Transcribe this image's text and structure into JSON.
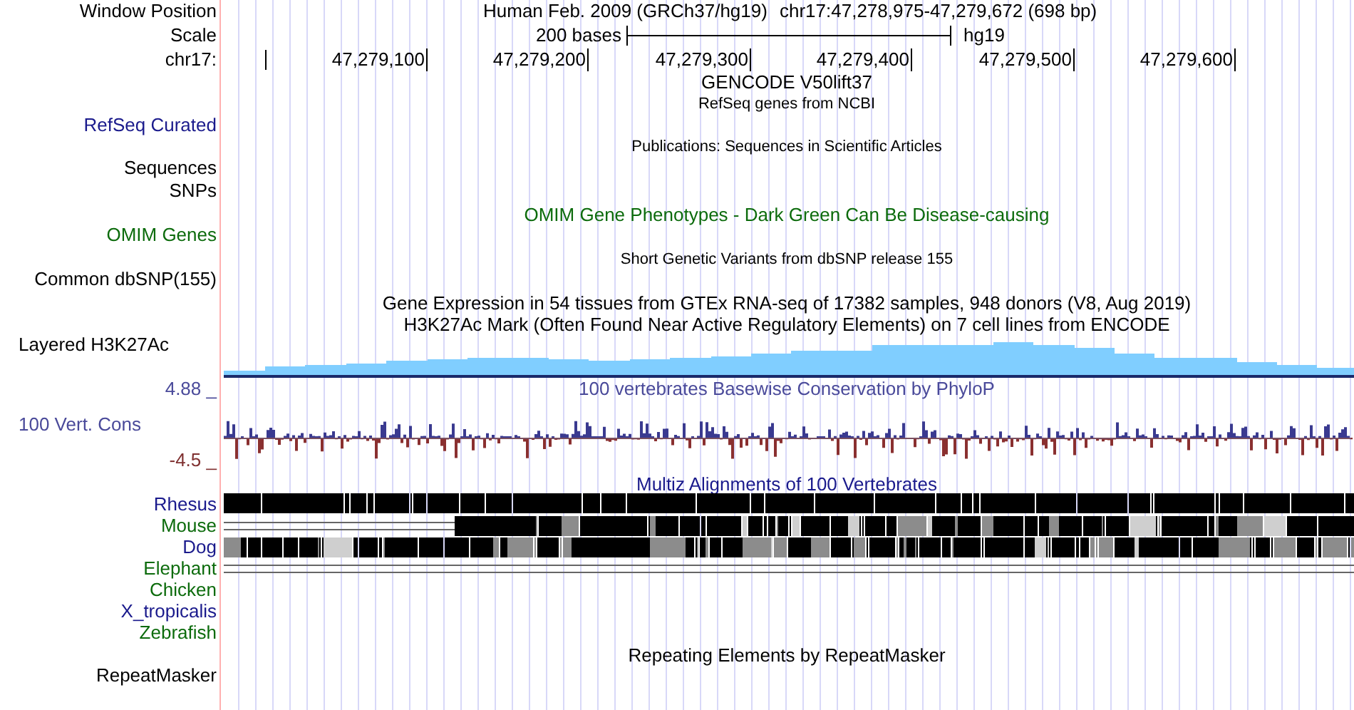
{
  "header": {
    "assembly_title": "Human Feb. 2009 (GRCh37/hg19)",
    "position": "chr17:47,278,975-47,279,672 (698 bp)",
    "scale_text": "200 bases",
    "scale_assembly": "hg19"
  },
  "ruler_ticks": [
    "47,279,100",
    "47,279,200",
    "47,279,300",
    "47,279,400",
    "47,279,500",
    "47,279,600"
  ],
  "side_labels": [
    {
      "text": "Window Position",
      "kind": "track",
      "color": "#000000"
    },
    {
      "text": "Scale",
      "kind": "track",
      "color": "#000000"
    },
    {
      "text": "chr17:",
      "kind": "track",
      "color": "#000000"
    },
    {
      "text": "RefSeq Curated",
      "kind": "track",
      "color": "#1a1a8c"
    },
    {
      "text": "Sequences",
      "kind": "track",
      "color": "#000000"
    },
    {
      "text": "SNPs",
      "kind": "track",
      "color": "#000000"
    },
    {
      "text": "OMIM Genes",
      "kind": "track",
      "color": "#0c6b0c"
    },
    {
      "text": "Common dbSNP(155)",
      "kind": "track",
      "color": "#000000"
    },
    {
      "text": "Layered H3K27Ac",
      "kind": "composite",
      "color": "#000000"
    },
    {
      "text": "4.88 _",
      "kind": "track",
      "color": "#4a4a9a"
    },
    {
      "text": "100 Vert. Cons",
      "kind": "composite",
      "color": "#4a4a9a"
    },
    {
      "text": "-4.5 _",
      "kind": "track",
      "color": "#7f3030"
    },
    {
      "text": "Rhesus",
      "kind": "track",
      "color": "#1a1a8c"
    },
    {
      "text": "Mouse",
      "kind": "track",
      "color": "#0c6b0c"
    },
    {
      "text": "Dog",
      "kind": "track",
      "color": "#1a1a8c"
    },
    {
      "text": "Elephant",
      "kind": "track",
      "color": "#0c6b0c"
    },
    {
      "text": "Chicken",
      "kind": "track",
      "color": "#0c6b0c"
    },
    {
      "text": "X_tropicalis",
      "kind": "track",
      "color": "#1a1a8c"
    },
    {
      "text": "Zebrafish",
      "kind": "track",
      "color": "#0c6b0c"
    },
    {
      "text": "RepeatMasker",
      "kind": "track",
      "color": "#000000"
    }
  ],
  "track_titles": [
    {
      "text": "GENCODE V50lift37",
      "kind": "large",
      "color": "#000000"
    },
    {
      "text": "RefSeq genes from NCBI",
      "kind": "small",
      "color": "#000000"
    },
    {
      "text": "Publications: Sequences in Scientific Articles",
      "kind": "small",
      "color": "#000000"
    },
    {
      "text": "OMIM Gene Phenotypes - Dark Green Can Be Disease-causing",
      "kind": "large",
      "color": "#0c6b0c"
    },
    {
      "text": "Short Genetic Variants from dbSNP release 155",
      "kind": "small",
      "color": "#000000"
    },
    {
      "text": "Gene Expression in 54 tissues from GTEx RNA-seq of 17382 samples, 948 donors (V8, Aug 2019)",
      "kind": "large",
      "color": "#000000"
    },
    {
      "text": "H3K27Ac Mark (Often Found Near Active Regulatory Elements) on 7 cell lines from ENCODE",
      "kind": "large",
      "color": "#000000"
    },
    {
      "text": "100 vertebrates Basewise Conservation by PhyloP",
      "kind": "large",
      "color": "#4a4a9a"
    },
    {
      "text": "Multiz Alignments of 100 Vertebrates",
      "kind": "large",
      "color": "#1a1a8c"
    },
    {
      "text": "Repeating Elements by RepeatMasker",
      "kind": "large",
      "color": "#000000"
    }
  ]
}
